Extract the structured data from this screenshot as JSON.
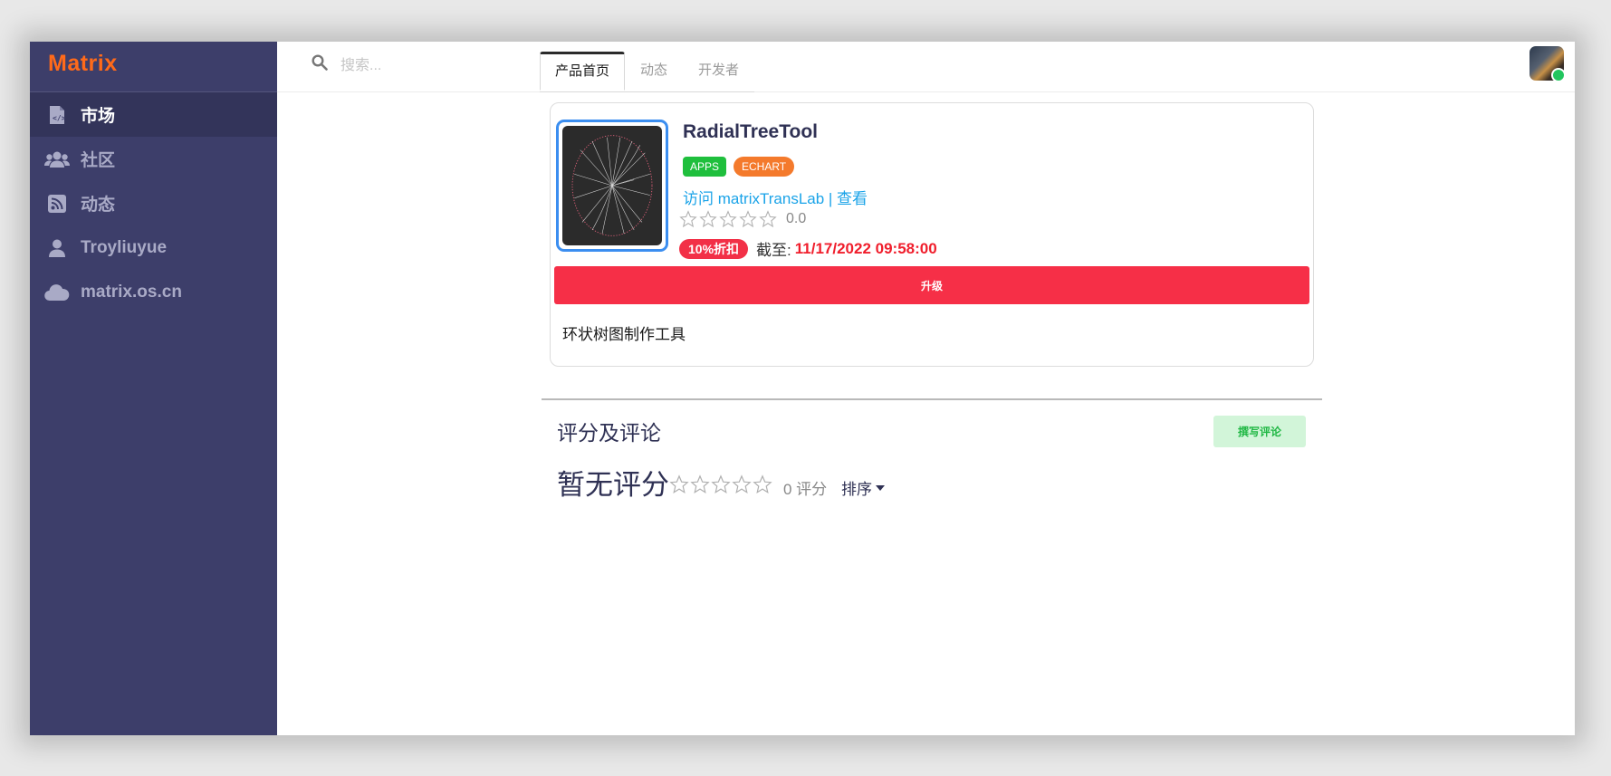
{
  "sidebar": {
    "brand": "Matrix",
    "items": [
      {
        "label": "市场",
        "icon": "file-code-icon",
        "active": true
      },
      {
        "label": "社区",
        "icon": "users-icon",
        "active": false
      },
      {
        "label": "动态",
        "icon": "rss-icon",
        "active": false
      },
      {
        "label": "Troyliuyue",
        "icon": "user-icon",
        "active": false
      },
      {
        "label": "matrix.os.cn",
        "icon": "cloud-icon",
        "active": false
      }
    ]
  },
  "header": {
    "search_placeholder": "搜索...",
    "tabs": [
      {
        "label": "产品首页",
        "active": true
      },
      {
        "label": "动态",
        "active": false
      },
      {
        "label": "开发者",
        "active": false
      }
    ],
    "user_status": "online"
  },
  "product": {
    "title": "RadialTreeTool",
    "badges": [
      {
        "label": "APPS",
        "color": "#1fbf3d"
      },
      {
        "label": "ECHART",
        "color": "#f47a2c"
      }
    ],
    "visit_link": "访问 matrixTransLab",
    "view_link": "| 查看",
    "rating": "0.0",
    "rating_stars": 0,
    "discount": "10%折扣",
    "deadline_label": "截至:",
    "deadline": "11/17/2022 09:58:00",
    "upgrade_label": "升级",
    "description": "环状树图制作工具"
  },
  "reviews": {
    "title": "评分及评论",
    "write_label": "撰写评论",
    "no_rating": "暂无评分",
    "count": "0 评分",
    "sort_label": "排序"
  },
  "colors": {
    "sidebar_bg": "#3d3e6a",
    "brand": "#ff6a1a",
    "link": "#1aa3e8",
    "danger": "#f62f47"
  }
}
